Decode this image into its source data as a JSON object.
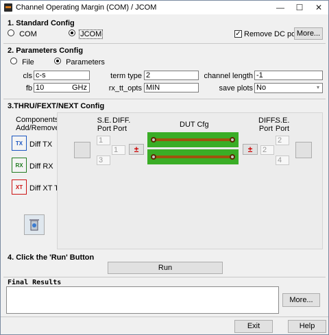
{
  "window": {
    "title": "Channel Operating Margin (COM) / JCOM",
    "minimize": "—",
    "maximize": "☐",
    "close": "✕"
  },
  "standard_config": {
    "heading": "1. Standard Config",
    "com_label": "COM",
    "jcom_label": "JCOM",
    "selected": "JCOM",
    "remove_dc_label": "Remove DC point",
    "remove_dc_checked": true,
    "more_label": "More..."
  },
  "parameters_config": {
    "heading": "2. Parameters Config",
    "file_label": "File",
    "parameters_label": "Parameters",
    "selected": "Parameters",
    "cls_label": "cls",
    "cls_value": "c-s",
    "fb_label": "fb",
    "fb_value": "10",
    "fb_unit": "GHz",
    "term_type_label": "term type",
    "term_type_value": "2",
    "rx_tt_opts_label": "rx_tt_opts",
    "rx_tt_opts_value": "MIN",
    "channel_length_label": "channel length",
    "channel_length_value": "-1",
    "save_plots_label": "save plots",
    "save_plots_value": "No"
  },
  "thru_config": {
    "heading": "3.THRU/FEXT/NEXT Config",
    "components_label_1": "Components",
    "components_label_2": "Add/Remove",
    "diff_tx": "Diff TX",
    "diff_rx": "Diff RX",
    "diff_xt_tx": "Diff XT TX",
    "tx_icon": "TX",
    "rx_icon": "RX",
    "xt_icon": "XT",
    "se_port_l1": "S.E.",
    "se_port_l2": "Port",
    "diff_port_l1": "DIFF.",
    "diff_port_l2": "Port",
    "dut_cfg": "DUT Cfg",
    "left_se_top": "1",
    "left_se_bottom": "3",
    "left_diff": "1",
    "right_se_top": "2",
    "right_se_bottom": "4",
    "right_diff": "2",
    "pm_symbol": "±"
  },
  "run_section": {
    "heading": "4. Click the 'Run' Button",
    "run_label": "Run"
  },
  "results": {
    "heading": "Final Results",
    "text": "",
    "more_label": "More..."
  },
  "footer": {
    "exit_label": "Exit",
    "help_label": "Help"
  }
}
